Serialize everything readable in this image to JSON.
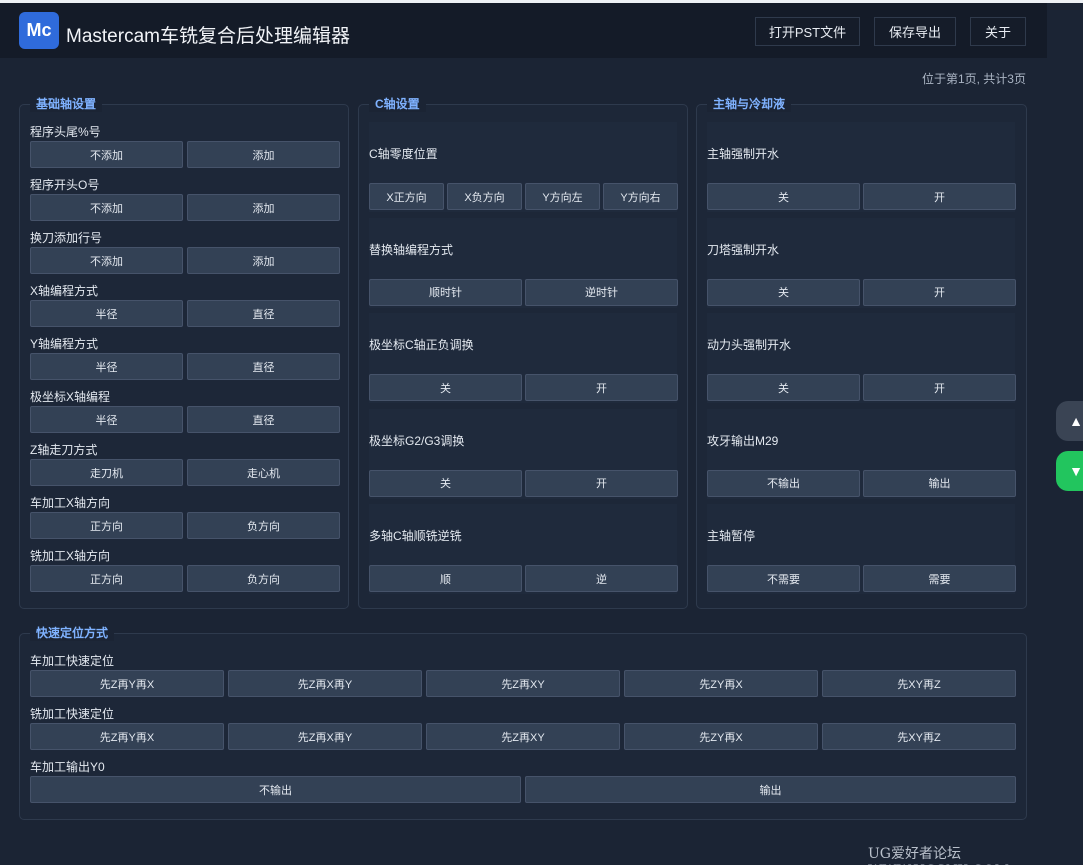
{
  "header": {
    "logo": "Mc",
    "title": "Mastercam车铣复合后处理编辑器",
    "buttons": [
      "打开PST文件",
      "保存导出",
      "关于"
    ]
  },
  "page_info": "位于第1页, 共计3页",
  "basic_axis": {
    "legend": "基础轴设置",
    "rows": [
      {
        "label": "程序头尾%号",
        "options": [
          "不添加",
          "添加"
        ]
      },
      {
        "label": "程序开头O号",
        "options": [
          "不添加",
          "添加"
        ]
      },
      {
        "label": "换刀添加行号",
        "options": [
          "不添加",
          "添加"
        ]
      },
      {
        "label": "X轴编程方式",
        "options": [
          "半径",
          "直径"
        ]
      },
      {
        "label": "Y轴编程方式",
        "options": [
          "半径",
          "直径"
        ]
      },
      {
        "label": "极坐标X轴编程",
        "options": [
          "半径",
          "直径"
        ]
      },
      {
        "label": "Z轴走刀方式",
        "options": [
          "走刀机",
          "走心机"
        ]
      },
      {
        "label": "车加工X轴方向",
        "options": [
          "正方向",
          "负方向"
        ]
      },
      {
        "label": "铣加工X轴方向",
        "options": [
          "正方向",
          "负方向"
        ]
      }
    ]
  },
  "c_axis": {
    "legend": "C轴设置",
    "rows": [
      {
        "label": "C轴零度位置",
        "options": [
          "X正方向",
          "X负方向",
          "Y方向左",
          "Y方向右"
        ]
      },
      {
        "label": "替换轴编程方式",
        "options": [
          "顺时针",
          "逆时针"
        ]
      },
      {
        "label": "极坐标C轴正负调换",
        "options": [
          "关",
          "开"
        ]
      },
      {
        "label": "极坐标G2/G3调换",
        "options": [
          "关",
          "开"
        ]
      },
      {
        "label": "多轴C轴顺铣逆铣",
        "options": [
          "顺",
          "逆"
        ]
      }
    ]
  },
  "spindle": {
    "legend": "主轴与冷却液",
    "rows": [
      {
        "label": "主轴强制开水",
        "options": [
          "关",
          "开"
        ]
      },
      {
        "label": "刀塔强制开水",
        "options": [
          "关",
          "开"
        ]
      },
      {
        "label": "动力头强制开水",
        "options": [
          "关",
          "开"
        ]
      },
      {
        "label": "攻牙输出M29",
        "options": [
          "不输出",
          "输出"
        ]
      },
      {
        "label": "主轴暂停",
        "options": [
          "不需要",
          "需要"
        ]
      }
    ]
  },
  "rapid": {
    "legend": "快速定位方式",
    "rows": [
      {
        "label": "车加工快速定位",
        "options": [
          "先Z再Y再X",
          "先Z再X再Y",
          "先Z再XY",
          "先ZY再X",
          "先XY再Z"
        ]
      },
      {
        "label": "铣加工快速定位",
        "options": [
          "先Z再Y再X",
          "先Z再X再Y",
          "先Z再XY",
          "先ZY再X",
          "先XY再Z"
        ]
      },
      {
        "label": "车加工输出Y0",
        "options": [
          "不输出",
          "输出"
        ]
      }
    ]
  },
  "side_buttons": {
    "up": "▲",
    "down": "▼"
  },
  "colors": {
    "accent": "#7fb2ff",
    "logo": "#2f6bdb",
    "down_button": "#22c55e"
  },
  "watermark": "UG爱好者论坛 WWW.UGSNX.COM"
}
